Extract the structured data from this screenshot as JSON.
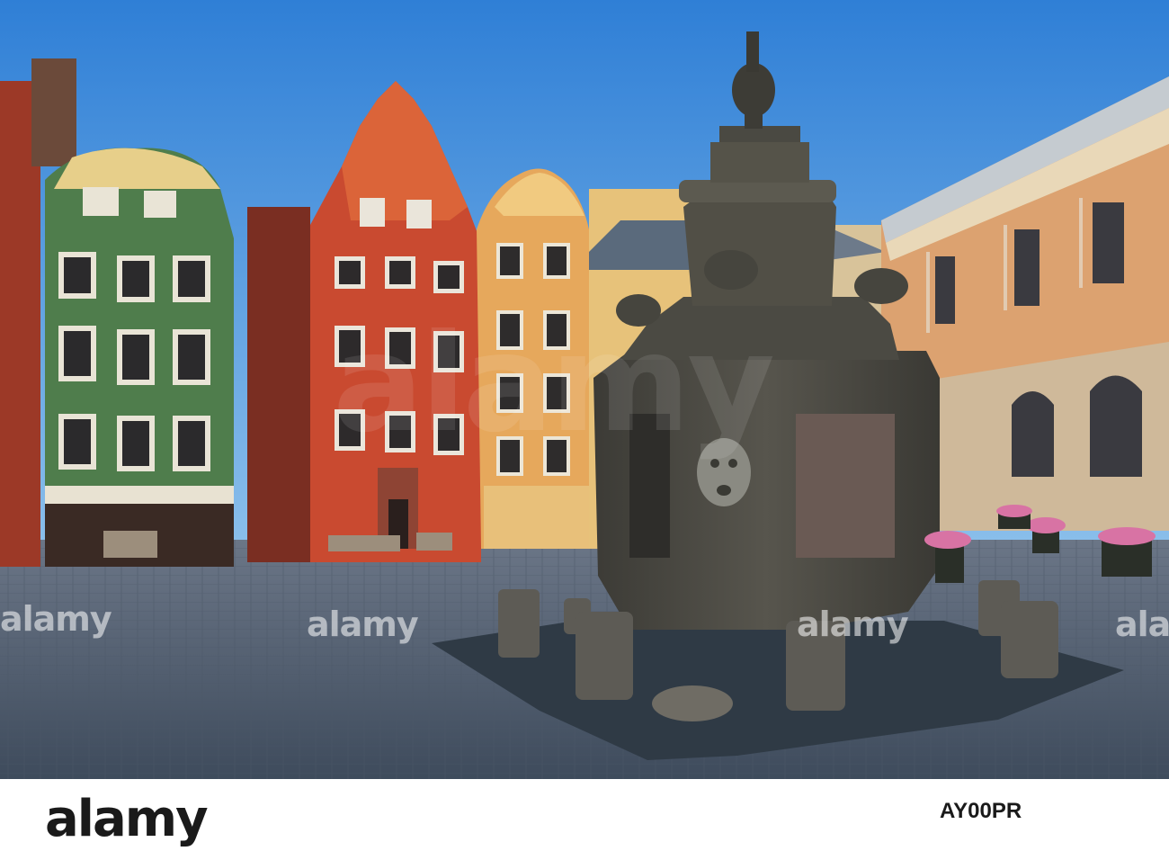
{
  "watermark": {
    "text": "alamy",
    "footer_logo": "alamy",
    "image_code": "AY00PR"
  },
  "palette": {
    "sky": "#3a86d6",
    "red_house": "#c8452e",
    "green_house": "#4c7a4a",
    "yellow_house": "#e0a45a",
    "academy": "#d9a06e",
    "cobblestone": "#5a6a7c",
    "fountain": "#4a4a44"
  },
  "scene": {
    "icons": [
      "building-icon",
      "fountain-icon",
      "flower-pot-icon",
      "bollard-icon"
    ]
  }
}
